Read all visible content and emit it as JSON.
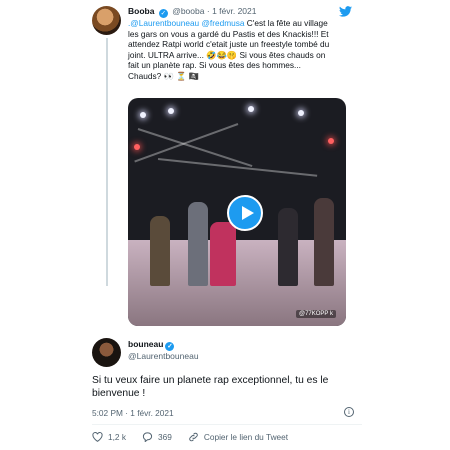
{
  "quoted": {
    "name": "Booba",
    "handle": "@booba",
    "sep": "·",
    "date": "1 févr. 2021",
    "text_lines": [
      [
        {
          "t": ".@Laurentbouneau @fredmusa",
          "m": true
        },
        {
          "t": " C'est la fête au village",
          "m": false
        }
      ],
      [
        {
          "t": "les gars on vous a gardé du Pastis et des Knackis!!! Et",
          "m": false
        }
      ],
      [
        {
          "t": "attendez Ratpi world c'etait juste un freestyle tombé du",
          "m": false
        }
      ],
      [
        {
          "t": "joint. ULTRA arrive... 🤣😂🤫  Si vous êtes chauds on",
          "m": false
        }
      ],
      [
        {
          "t": "fait un planète rap. Si vous êtes des hommes...",
          "m": false
        }
      ],
      [
        {
          "t": "Chauds? 👀 ⏳ 🏴‍☠️",
          "m": false
        }
      ]
    ],
    "video_watermark": "@77KOPP k"
  },
  "tweet": {
    "name": "bouneau",
    "handle": "@Laurentbouneau",
    "text_line1": "Si tu veux faire un planete rap exceptionnel, tu es le",
    "text_line2": "bienvenue !",
    "meta": "5:02 PM · 1 févr. 2021"
  },
  "actions": {
    "likes": "1,2 k",
    "replies": "369",
    "copy_link": "Copier le lien du Tweet"
  },
  "icons": {
    "verified": "verified-badge-icon",
    "twitter": "twitter-bird-icon",
    "like": "heart-icon",
    "reply": "reply-icon",
    "link": "link-icon",
    "info": "info-icon",
    "play": "play-icon"
  },
  "colors": {
    "accent": "#1d9bf0",
    "text": "#0f1419",
    "muted": "#536471"
  }
}
